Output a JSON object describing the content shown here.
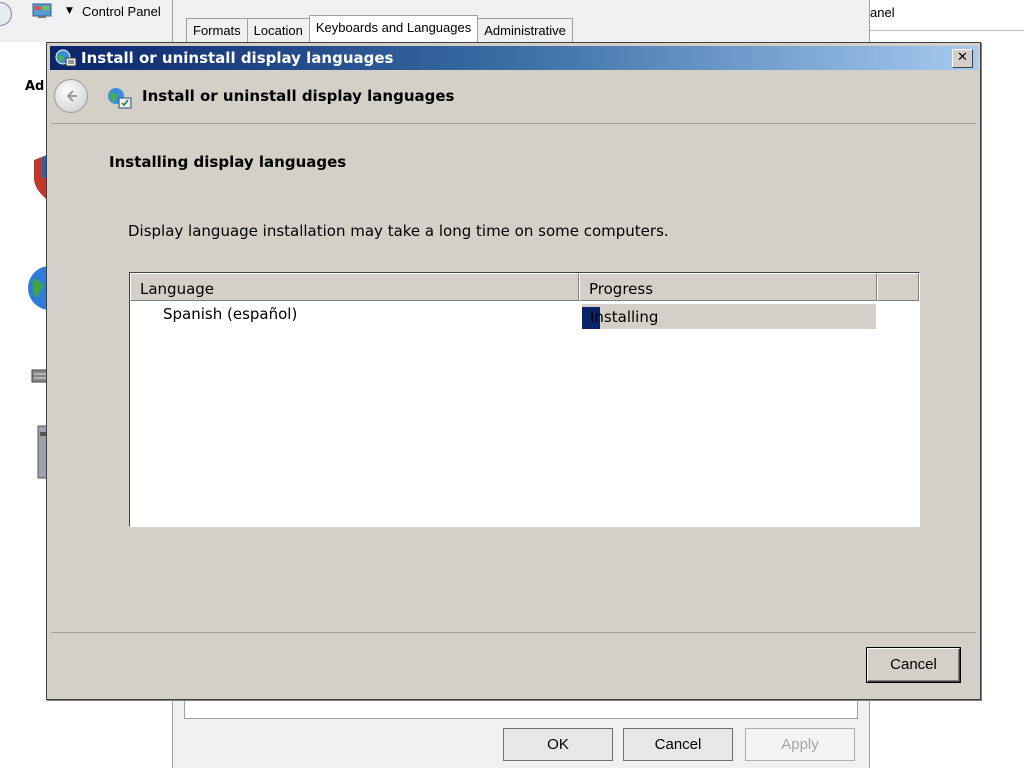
{
  "background_window": {
    "address_text": "Control Panel",
    "search_text": "anel",
    "sidebar_heading": "Ad"
  },
  "regional_dialog": {
    "tabs": [
      {
        "label": "Formats",
        "active": false
      },
      {
        "label": "Location",
        "active": false
      },
      {
        "label": "Keyboards and Languages",
        "active": true
      },
      {
        "label": "Administrative",
        "active": false
      }
    ],
    "buttons": {
      "ok": "OK",
      "cancel": "Cancel",
      "apply": "Apply"
    }
  },
  "dialog": {
    "title": "Install or uninstall display languages",
    "header_title": "Install or uninstall display languages",
    "section_title": "Installing display languages",
    "description": "Display language installation may take a long time on some computers.",
    "table": {
      "columns": [
        "Language",
        "Progress"
      ],
      "rows": [
        {
          "language": "Spanish (español)",
          "status": "Installing",
          "progress_percent": 6
        }
      ]
    },
    "cancel_label": "Cancel"
  },
  "colors": {
    "titlebar_start": "#0a246a",
    "titlebar_end": "#a6caf0",
    "dialog_face": "#d4d0c8",
    "progress_fill": "#0a246a"
  },
  "icons": {
    "back": "back-arrow-icon",
    "title": "language-globe-icon",
    "close": "close-icon"
  }
}
